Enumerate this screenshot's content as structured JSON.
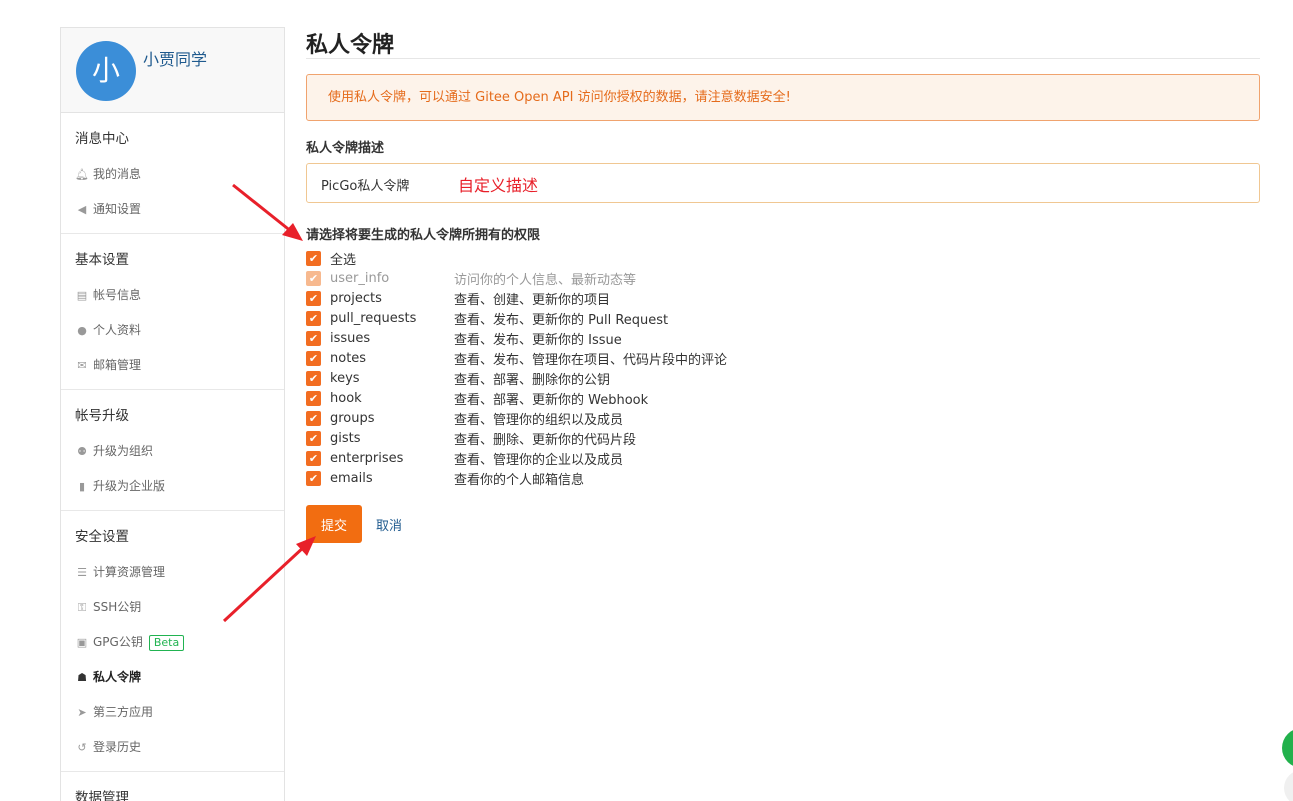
{
  "user": {
    "avatar_char": "小",
    "name": "小贾同学"
  },
  "sidebar": {
    "sections": [
      {
        "title": "消息中心",
        "items": [
          {
            "label": "我的消息",
            "icon": "bell-icon"
          },
          {
            "label": "通知设置",
            "icon": "speaker-icon"
          }
        ]
      },
      {
        "title": "基本设置",
        "items": [
          {
            "label": "帐号信息",
            "icon": "id-card-icon"
          },
          {
            "label": "个人资料",
            "icon": "user-icon"
          },
          {
            "label": "邮箱管理",
            "icon": "envelope-icon"
          }
        ]
      },
      {
        "title": "帐号升级",
        "items": [
          {
            "label": "升级为组织",
            "icon": "users-icon"
          },
          {
            "label": "升级为企业版",
            "icon": "building-icon"
          }
        ]
      },
      {
        "title": "安全设置",
        "items": [
          {
            "label": "计算资源管理",
            "icon": "server-icon"
          },
          {
            "label": "SSH公钥",
            "icon": "key-icon"
          },
          {
            "label": "GPG公钥",
            "icon": "lock-icon",
            "badge": "Beta"
          },
          {
            "label": "私人令牌",
            "icon": "token-icon",
            "active": true
          },
          {
            "label": "第三方应用",
            "icon": "rocket-icon"
          },
          {
            "label": "登录历史",
            "icon": "history-icon"
          }
        ]
      },
      {
        "title": "数据管理",
        "items": []
      }
    ]
  },
  "main": {
    "title": "私人令牌",
    "notice": "使用私人令牌，可以通过 Gitee Open API 访问你授权的数据，请注意数据安全!",
    "desc_label": "私人令牌描述",
    "desc_value": "PicGo私人令牌",
    "desc_annotation": "自定义描述",
    "perm_title": "请选择将要生成的私人令牌所拥有的权限",
    "select_all": "全选",
    "permissions": [
      {
        "name": "user_info",
        "desc": "访问你的个人信息、最新动态等",
        "disabled": true
      },
      {
        "name": "projects",
        "desc": "查看、创建、更新你的项目"
      },
      {
        "name": "pull_requests",
        "desc": "查看、发布、更新你的 Pull Request"
      },
      {
        "name": "issues",
        "desc": "查看、发布、更新你的 Issue"
      },
      {
        "name": "notes",
        "desc": "查看、发布、管理你在项目、代码片段中的评论"
      },
      {
        "name": "keys",
        "desc": "查看、部署、删除你的公钥"
      },
      {
        "name": "hook",
        "desc": "查看、部署、更新你的 Webhook"
      },
      {
        "name": "groups",
        "desc": "查看、管理你的组织以及成员"
      },
      {
        "name": "gists",
        "desc": "查看、删除、更新你的代码片段"
      },
      {
        "name": "enterprises",
        "desc": "查看、管理你的企业以及成员"
      },
      {
        "name": "emails",
        "desc": "查看你的个人邮箱信息"
      }
    ],
    "submit_label": "提交",
    "cancel_label": "取消"
  },
  "colors": {
    "accent": "#f26d11",
    "link": "#1f5a8e",
    "annotation": "#e8202a",
    "beta": "#21b351"
  }
}
